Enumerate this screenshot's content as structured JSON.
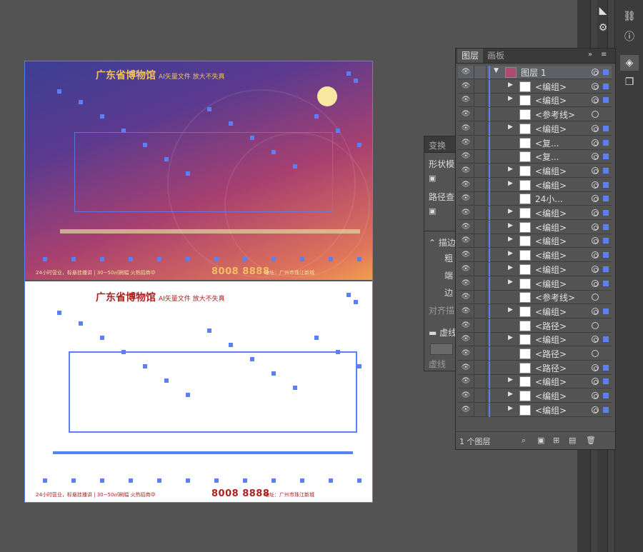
{
  "artboard": {
    "title": "广东省博物馆",
    "subtitle": "AI矢量文件 放大不失真",
    "phone": "8008 8888",
    "footer_left": "24小时营业，标悬挂播讲 | 30~50㎡刷幅 火热招商中",
    "footer_right": "地址：广州市珠江新城",
    "colors": {
      "title_top": "#f0c060",
      "title_bottom": "#b02020",
      "selection": "#5b7ff5"
    }
  },
  "transform_panel": {
    "title": "变换",
    "shape_label": "形状模",
    "pathfinder_label": "路径查:",
    "stroke_label": "描边",
    "weight_label": "粗",
    "cap_label": "端",
    "corner_label": "边",
    "align_label": "对齐描",
    "dashed_label": "虚线",
    "dash_label": "虚线"
  },
  "layers_panel": {
    "tabs": [
      "图层",
      "画板"
    ],
    "active_tab": "图层",
    "rows": [
      {
        "name": "图层 1",
        "arrow": "▼",
        "target": "double",
        "selected": true,
        "top": true
      },
      {
        "name": "<编组>",
        "arrow": "▶",
        "target": "double",
        "selected": true
      },
      {
        "name": "<编组>",
        "arrow": "▶",
        "target": "double",
        "selected": true
      },
      {
        "name": "<参考线>",
        "arrow": "",
        "target": "single",
        "selected": false
      },
      {
        "name": "<编组>",
        "arrow": "▶",
        "target": "double",
        "selected": true
      },
      {
        "name": "<复...",
        "arrow": "",
        "target": "double",
        "selected": true
      },
      {
        "name": "<复...",
        "arrow": "",
        "target": "double",
        "selected": true
      },
      {
        "name": "<编组>",
        "arrow": "▶",
        "target": "double",
        "selected": true
      },
      {
        "name": "<编组>",
        "arrow": "▶",
        "target": "double",
        "selected": true
      },
      {
        "name": "24小...",
        "arrow": "",
        "target": "double",
        "selected": true
      },
      {
        "name": "<编组>",
        "arrow": "▶",
        "target": "double",
        "selected": true
      },
      {
        "name": "<编组>",
        "arrow": "▶",
        "target": "double",
        "selected": true
      },
      {
        "name": "<编组>",
        "arrow": "▶",
        "target": "double",
        "selected": true
      },
      {
        "name": "<编组>",
        "arrow": "▶",
        "target": "double",
        "selected": true
      },
      {
        "name": "<编组>",
        "arrow": "▶",
        "target": "double",
        "selected": true
      },
      {
        "name": "<编组>",
        "arrow": "▶",
        "target": "double",
        "selected": true
      },
      {
        "name": "<参考线>",
        "arrow": "",
        "target": "single",
        "selected": false
      },
      {
        "name": "<编组>",
        "arrow": "▶",
        "target": "double",
        "selected": true
      },
      {
        "name": "<路径>",
        "arrow": "",
        "target": "single",
        "selected": false
      },
      {
        "name": "<编组>",
        "arrow": "▶",
        "target": "double",
        "selected": true
      },
      {
        "name": "<路径>",
        "arrow": "",
        "target": "single",
        "selected": false
      },
      {
        "name": "<路径>",
        "arrow": "",
        "target": "double",
        "selected": true
      },
      {
        "name": "<编组>",
        "arrow": "▶",
        "target": "double",
        "selected": true
      },
      {
        "name": "<编组>",
        "arrow": "▶",
        "target": "double",
        "selected": true
      },
      {
        "name": "<编组>",
        "arrow": "▶",
        "target": "double",
        "selected": true
      }
    ],
    "footer_count": "1 个图层"
  }
}
